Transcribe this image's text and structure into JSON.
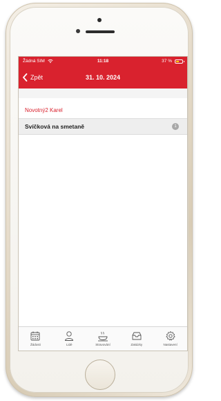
{
  "status_bar": {
    "carrier": "Žádná SIM",
    "time": "11:18",
    "battery": "37 %"
  },
  "nav": {
    "back_label": "Zpět",
    "title": "31. 10. 2024"
  },
  "section": {
    "header": "Novotný2 Karel"
  },
  "items": [
    {
      "label": "Svíčková na smetaně",
      "count": "1"
    }
  ],
  "tabs": [
    {
      "label": "Žádosti",
      "icon": "calendar-icon"
    },
    {
      "label": "Lidé",
      "icon": "person-icon"
    },
    {
      "label": "Stravování",
      "icon": "food-icon"
    },
    {
      "label": "Zakázky",
      "icon": "inbox-icon"
    },
    {
      "label": "Nastavení",
      "icon": "gear-icon"
    }
  ],
  "colors": {
    "accent": "#d9222e",
    "battery": "#f5d300"
  }
}
